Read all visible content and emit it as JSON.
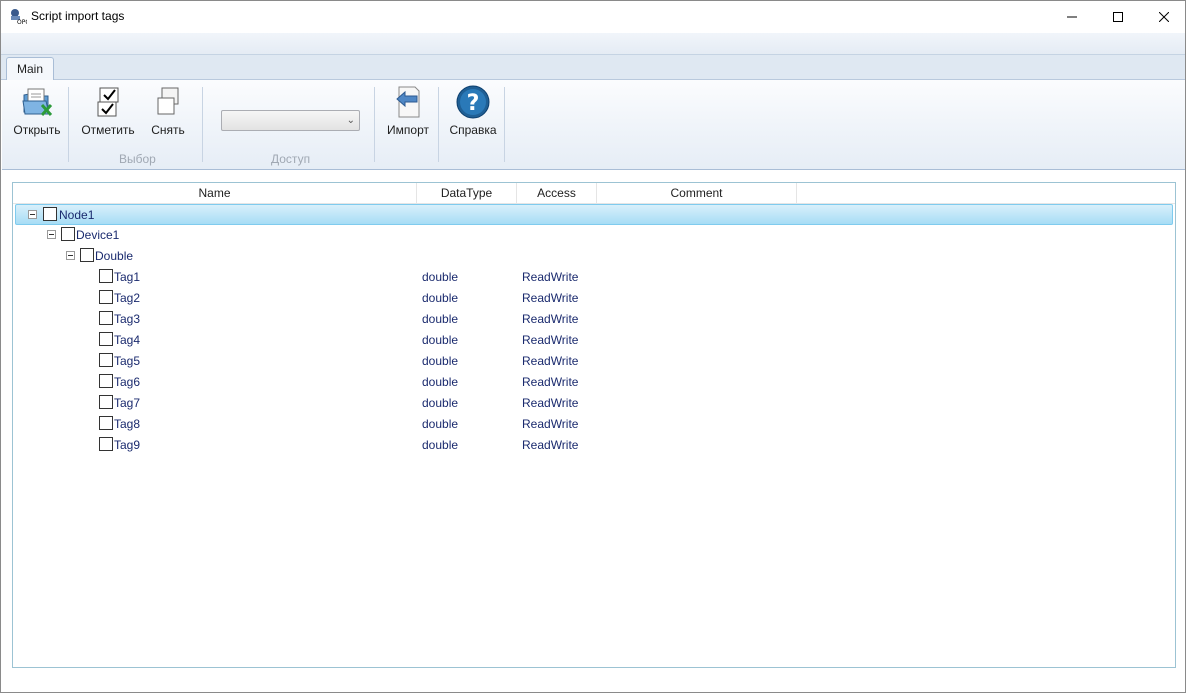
{
  "window": {
    "title": "Script import tags"
  },
  "ribbon": {
    "tab_main": "Main",
    "buttons": {
      "open": "Открыть",
      "mark": "Отметить",
      "unmark": "Снять",
      "import": "Импорт",
      "help": "Справка"
    },
    "groups": {
      "selection": "Выбор",
      "access": "Доступ"
    },
    "access_combo_value": ""
  },
  "grid": {
    "columns": [
      "Name",
      "DataType",
      "Access",
      "Comment"
    ],
    "tree": {
      "node": "Node1",
      "device": "Device1",
      "folder": "Double"
    },
    "tags": [
      {
        "name": "Tag1",
        "datatype": "double",
        "access": "ReadWrite"
      },
      {
        "name": "Tag2",
        "datatype": "double",
        "access": "ReadWrite"
      },
      {
        "name": "Tag3",
        "datatype": "double",
        "access": "ReadWrite"
      },
      {
        "name": "Tag4",
        "datatype": "double",
        "access": "ReadWrite"
      },
      {
        "name": "Tag5",
        "datatype": "double",
        "access": "ReadWrite"
      },
      {
        "name": "Tag6",
        "datatype": "double",
        "access": "ReadWrite"
      },
      {
        "name": "Tag7",
        "datatype": "double",
        "access": "ReadWrite"
      },
      {
        "name": "Tag8",
        "datatype": "double",
        "access": "ReadWrite"
      },
      {
        "name": "Tag9",
        "datatype": "double",
        "access": "ReadWrite"
      }
    ]
  },
  "icons": {
    "app": "opc-app-icon",
    "open": "open-file-excel-icon",
    "mark": "check-all-icon",
    "unmark": "uncheck-all-icon",
    "import": "import-arrow-icon",
    "help": "help-icon"
  },
  "colors": {
    "accent_selection": "#a7ddf5",
    "tree_text": "#1a2a6e",
    "grid_border": "#9cc3d3"
  }
}
